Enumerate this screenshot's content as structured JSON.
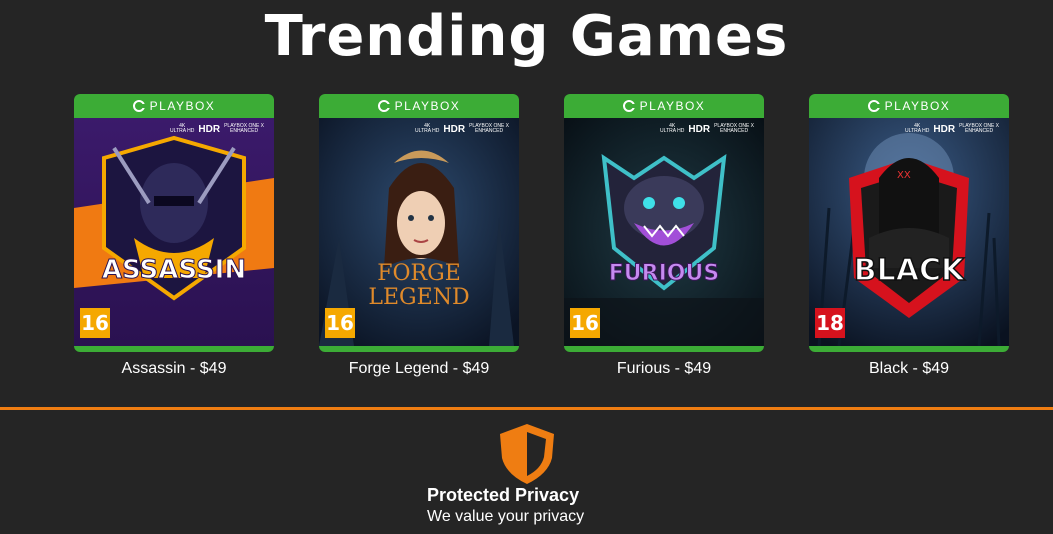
{
  "page": {
    "title": "Trending Games"
  },
  "brand": {
    "name": "PLAYBOX",
    "accent": "#3cac36",
    "orange": "#ef7d12"
  },
  "badges": {
    "resolution_top": "4K",
    "resolution_bottom": "ULTRA HD",
    "hdr": "HDR",
    "platform_top": "PLAYBOX ONE X",
    "platform_bottom": "ENHANCED"
  },
  "games": [
    {
      "art_text": "ASSASSIN",
      "rating": "16",
      "rating_color": "#f5a800",
      "caption": "Assassin - $49"
    },
    {
      "art_text_1": "FORGE",
      "art_text_2": "LEGEND",
      "rating": "16",
      "rating_color": "#f5a800",
      "caption": "Forge Legend - $49"
    },
    {
      "art_text": "FURIOUS",
      "rating": "16",
      "rating_color": "#f5a800",
      "caption": "Furious - $49"
    },
    {
      "art_text": "BLACK",
      "rating": "18",
      "rating_color": "#d6121d",
      "caption": "Black - $49"
    }
  ],
  "privacy": {
    "icon": "shield-icon",
    "title": "Protected Privacy",
    "subtitle": "We value your privacy"
  }
}
